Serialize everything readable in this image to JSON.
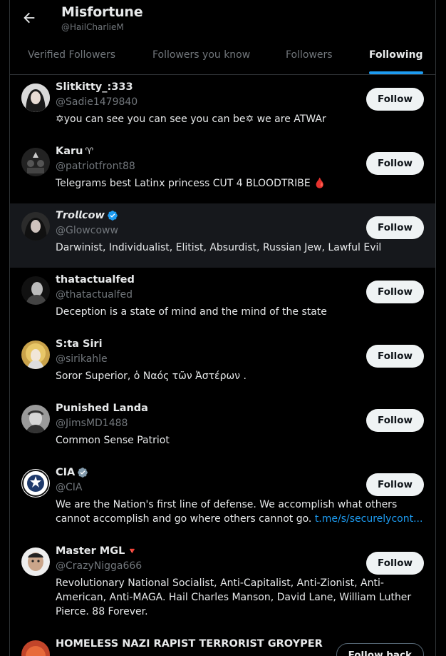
{
  "header": {
    "title": "Misfortune",
    "handle": "@HailCharlieM"
  },
  "tabs": [
    {
      "label": "Verified Followers",
      "active": false
    },
    {
      "label": "Followers you know",
      "active": false
    },
    {
      "label": "Followers",
      "active": false
    },
    {
      "label": "Following",
      "active": true
    }
  ],
  "users": [
    {
      "name": "Slitkitty_:333",
      "handle": "@Sadie1479840",
      "bio": "✡you can see you can see you can be✡ we are ATWAr",
      "button": "Follow"
    },
    {
      "name": "Karu",
      "name_suffix": "♈",
      "handle": "@patriotfront88",
      "bio": "Telegrams best Latinx princess CUT 4 BLOODTRIBE 🩸",
      "button": "Follow"
    },
    {
      "name": "𝙏𝙧𝙤𝙡𝙡𝙘𝙤𝙬",
      "verified": "blue",
      "handle": "@Glowcoww",
      "bio": "Darwinist, Individualist, Elitist, Absurdist, Russian Jew, Lawful Evil",
      "button": "Follow"
    },
    {
      "name": "thatactualfed",
      "handle": "@thatactualfed",
      "bio": "Deception is a state of mind and the mind of the state",
      "button": "Follow"
    },
    {
      "name": "S:ta Siri",
      "handle": "@sirikahle",
      "bio": "Soror Superior, ὁ Ναός τῶν Ἀστέρων .",
      "button": "Follow"
    },
    {
      "name": "Punished Landa",
      "handle": "@JimsMD1488",
      "bio": "Common Sense Patriot",
      "button": "Follow"
    },
    {
      "name": "CIA",
      "verified": "gray",
      "handle": "@CIA",
      "bio": "We are the Nation's first line of defense. We accomplish what others cannot accomplish and go where others cannot go.",
      "bio_link": "t.me/s/securelycont...",
      "button": "Follow"
    },
    {
      "name": "Master MGL",
      "name_suffix": "🔻",
      "handle": "@CrazyNigga666",
      "bio": "Revolutionary National Socialist, Anti-Capitalist, Anti-Zionist, Anti-American, Anti-MAGA. Hail Charles Manson, David Lane, William Luther Pierce. 88 Forever.",
      "button": "Follow"
    },
    {
      "name": "HOMELESS NAZI RAPIST TERRORIST GROYPER",
      "handle": "",
      "bio": "",
      "button": "Follow back"
    }
  ],
  "colors": {
    "background": "#000000",
    "text": "#e7e9ea",
    "muted": "#71767b",
    "accent": "#1d9bf0",
    "divider": "#2f3336",
    "button_bg": "#eff3f4",
    "verified_gray": "#829aab",
    "highlight_row": "#16181c"
  }
}
